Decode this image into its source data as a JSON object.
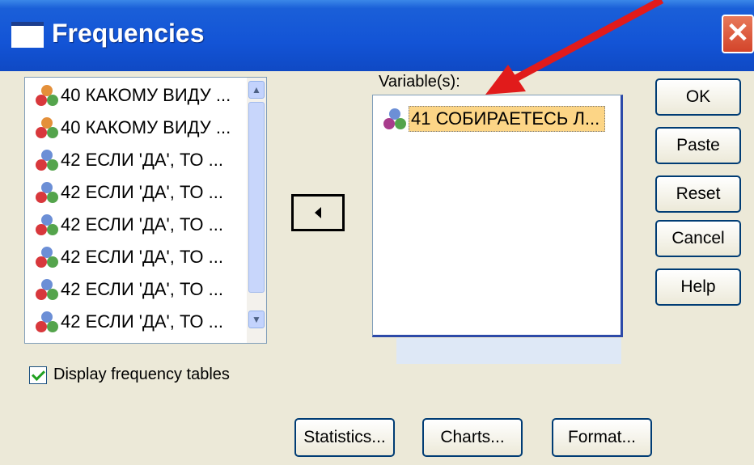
{
  "window": {
    "title": "Frequencies",
    "close_glyph": "✕"
  },
  "source_list": {
    "items": [
      "40 КАКОМУ ВИДУ ...",
      "40 КАКОМУ ВИДУ ...",
      "42 ЕСЛИ 'ДА', ТО ...",
      "42 ЕСЛИ 'ДА', ТО ...",
      "42 ЕСЛИ 'ДА', ТО ...",
      "42 ЕСЛИ 'ДА', ТО ...",
      "42 ЕСЛИ 'ДА', ТО ...",
      "42 ЕСЛИ 'ДА', ТО ..."
    ]
  },
  "target": {
    "label": "Variable(s):",
    "items": [
      "41 СОБИРАЕТЕСЬ Л..."
    ]
  },
  "buttons": {
    "ok": "OK",
    "paste": "Paste",
    "reset": "Reset",
    "cancel": "Cancel",
    "help": "Help",
    "statistics": "Statistics...",
    "charts": "Charts...",
    "format": "Format..."
  },
  "checkbox": {
    "label": "Display frequency tables",
    "checked": true
  },
  "icons": {
    "variable": "nominal-variable-icon",
    "move": "left-arrow-icon",
    "annotation": "red-pointer-arrow"
  },
  "colors": {
    "title_bar": "#1354d6",
    "selection": "#fcd586",
    "annotation_arrow": "#e11b1b"
  }
}
